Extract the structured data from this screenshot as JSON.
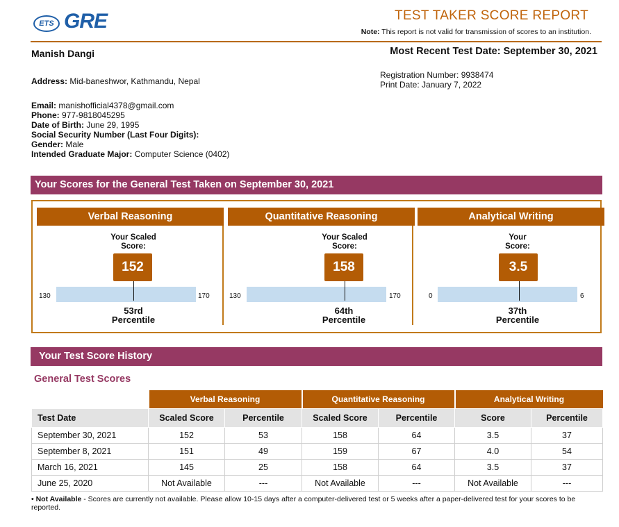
{
  "logo": {
    "ets": "ETS",
    "gre": "GRE"
  },
  "header": {
    "title": "TEST TAKER SCORE REPORT",
    "note_label": "Note:",
    "note_text": " This report is not valid for transmission of scores to an institution.",
    "recent_label": "Most Recent Test Date: September 30, 2021"
  },
  "candidate": {
    "name": "Manish Dangi",
    "address_label": "Address:",
    "address": " Mid-baneshwor, Kathmandu, Nepal",
    "registration": "Registration Number: 9938474",
    "print_date": "Print Date: January 7, 2022",
    "email_label": "Email:",
    "email": " manishofficial4378@gmail.com",
    "phone_label": "Phone:",
    "phone": " 977-9818045295",
    "dob_label": "Date of Birth:",
    "dob": " June 29, 1995",
    "ssn_label": "Social Security Number (Last Four Digits):",
    "gender_label": "Gender:",
    "gender": " Male",
    "major_label": "Intended Graduate Major:",
    "major": " Computer Science (0402)"
  },
  "general": {
    "heading": "Your Scores for the General Test Taken on September 30, 2021",
    "sections": [
      {
        "name": "Verbal Reasoning",
        "label_line1": "Your Scaled",
        "label_line2": "Score:",
        "score": "152",
        "min": "130",
        "max": "170",
        "score_fraction": 0.55,
        "percentile": "53rd",
        "percentile_word": "Percentile"
      },
      {
        "name": "Quantitative Reasoning",
        "label_line1": "Your Scaled",
        "label_line2": "Score:",
        "score": "158",
        "min": "130",
        "max": "170",
        "score_fraction": 0.7,
        "percentile": "64th",
        "percentile_word": "Percentile"
      },
      {
        "name": "Analytical Writing",
        "label_line1": "Your",
        "label_line2": "Score:",
        "score": "3.5",
        "min": "0",
        "max": "6",
        "score_fraction": 0.5833,
        "percentile": "37th",
        "percentile_word": "Percentile"
      }
    ]
  },
  "history": {
    "heading": "Your Test Score History",
    "subheading": "General Test Scores",
    "groups": [
      "Verbal Reasoning",
      "Quantitative Reasoning",
      "Analytical Writing"
    ],
    "columns": [
      "Test Date",
      "Scaled Score",
      "Percentile",
      "Scaled Score",
      "Percentile",
      "Score",
      "Percentile"
    ],
    "rows": [
      [
        "September 30, 2021",
        "152",
        "53",
        "158",
        "64",
        "3.5",
        "37"
      ],
      [
        "September 8, 2021",
        "151",
        "49",
        "159",
        "67",
        "4.0",
        "54"
      ],
      [
        "March 16, 2021",
        "145",
        "25",
        "158",
        "64",
        "3.5",
        "37"
      ],
      [
        "June 25, 2020",
        "Not Available",
        "---",
        "Not Available",
        "---",
        "Not Available",
        "---"
      ]
    ]
  },
  "footnote": {
    "label": "• Not Available",
    "text": " - Scores are currently not available. Please allow 10-15 days after a computer-delivered test or 5 weeks after a paper-delivered test for your scores to be reported."
  },
  "colors": {
    "accent": "#b35c05",
    "section_bar": "#963963",
    "bar_fill": "#c5dcef",
    "brand_blue": "#1f5fa8"
  }
}
